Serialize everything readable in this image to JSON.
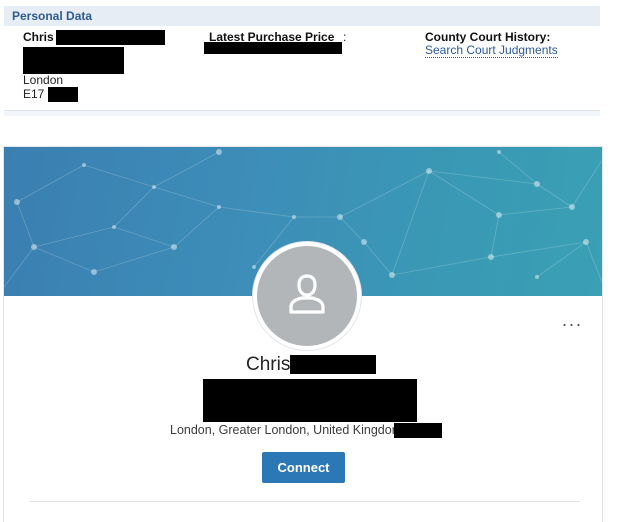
{
  "personal_data": {
    "title": "Personal Data",
    "name_visible": "Chris",
    "city": "London",
    "postcode": "E17",
    "latest_purchase_price_label": "Latest Purchase Price",
    "county_court_label": "County Court History:",
    "county_court_link": "Search Court Judgments"
  },
  "profile": {
    "name_visible": "Chris",
    "location": "London, Greater London, United Kingdom",
    "connect_label": "Connect",
    "more_label": "···"
  },
  "colors": {
    "header_text": "#2c5c8f",
    "link": "#2a5a9a",
    "banner": "#3a8fb6",
    "connect_button": "#2c77b6"
  },
  "icons": [
    "person-silhouette-icon",
    "more-options-icon"
  ]
}
